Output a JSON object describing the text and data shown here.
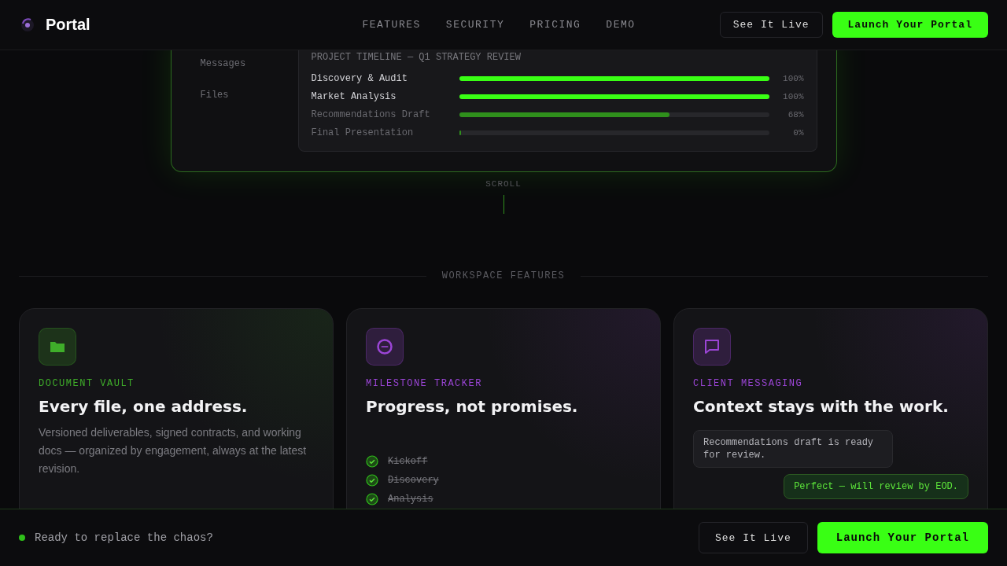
{
  "header": {
    "brand": "Portal",
    "nav": [
      {
        "label": "FEATURES"
      },
      {
        "label": "SECURITY"
      },
      {
        "label": "PRICING"
      },
      {
        "label": "DEMO"
      }
    ],
    "secondary_button": "See It Live",
    "primary_button": "Launch Your Portal"
  },
  "dashboard": {
    "sidebar_items": [
      "Messages",
      "Files"
    ],
    "timeline": {
      "title": "PROJECT TIMELINE — Q1 STRATEGY REVIEW",
      "rows": [
        {
          "name": "Discovery & Audit",
          "level": 1,
          "reading": "100%"
        },
        {
          "name": "Market Analysis",
          "level": 1,
          "reading": "100%"
        },
        {
          "name": "Recommendations Draft",
          "level": 0.68,
          "reading": "68%"
        },
        {
          "name": "Final Presentation",
          "level": 0,
          "reading": "0%"
        }
      ]
    }
  },
  "scroll_hint": "SCROLL",
  "section_title": "WORKSPACE FEATURES",
  "cards": [
    {
      "kind": "text",
      "color": "#3fae2a",
      "eyebrow": "DOCUMENT VAULT",
      "title": "Every file, one address.",
      "body": "Versioned deliverables, signed contracts, and working docs — organized by engagement, always at the latest revision."
    },
    {
      "kind": "milestones",
      "color": "#9b45d6",
      "eyebrow": "MILESTONE TRACKER",
      "title": "Progress, not promises.",
      "milestones": [
        {
          "label": "Kickoff",
          "done": true
        },
        {
          "label": "Discovery",
          "done": true
        },
        {
          "label": "Analysis",
          "done": true
        }
      ]
    },
    {
      "kind": "chat",
      "color": "#9b45d6",
      "eyebrow": "CLIENT MESSAGING",
      "title": "Context stays with the work.",
      "messages": [
        {
          "kind": "incoming",
          "text": "Recommendations draft is ready for review."
        },
        {
          "kind": "outgoing",
          "text": "Perfect — will review by EOD."
        }
      ]
    }
  ],
  "cta_bar": {
    "text": "Ready to replace the chaos?",
    "secondary_button": "See It Live",
    "primary_button": "Launch Your Portal"
  }
}
